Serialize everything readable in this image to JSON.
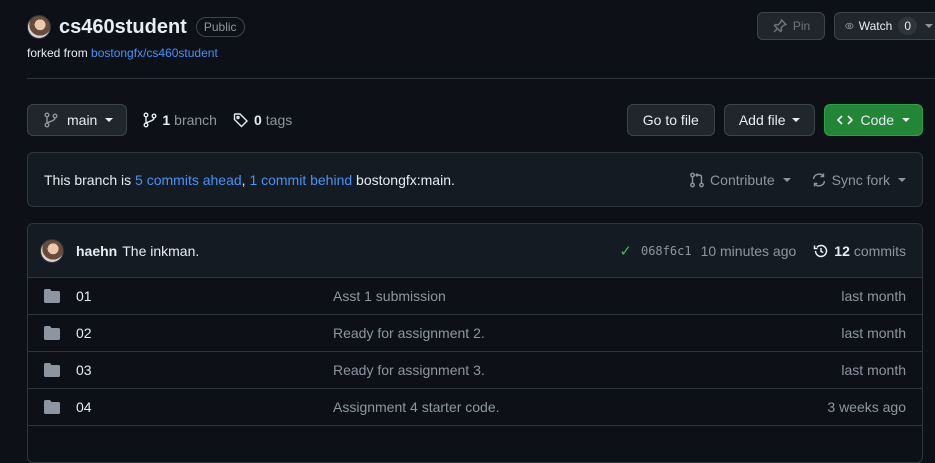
{
  "repo": {
    "name": "cs460student",
    "visibility": "Public",
    "fork_prefix": "forked from",
    "fork_source": "bostongfx/cs460student"
  },
  "header_actions": {
    "pin_label": "Pin",
    "watch_label": "Watch",
    "watch_count": "0"
  },
  "toolbar": {
    "branch_name": "main",
    "branch_count": "1",
    "branch_label": "branch",
    "tag_count": "0",
    "tag_label": "tags",
    "go_to_file": "Go to file",
    "add_file": "Add file",
    "code": "Code"
  },
  "branch_status": {
    "prefix": "This branch is",
    "ahead": "5 commits ahead",
    "sep": ",",
    "behind": "1 commit behind",
    "target": "bostongfx:main."
  },
  "status_actions": {
    "contribute": "Contribute",
    "sync_fork": "Sync fork"
  },
  "latest_commit": {
    "author": "haehn",
    "message": "The inkman.",
    "sha": "068f6c1",
    "time": "10 minutes ago",
    "commit_count": "12",
    "commit_label": "commits"
  },
  "files": [
    {
      "name": "01",
      "message": "Asst 1 submission",
      "time": "last month"
    },
    {
      "name": "02",
      "message": "Ready for assignment 2.",
      "time": "last month"
    },
    {
      "name": "03",
      "message": "Ready for assignment 3.",
      "time": "last month"
    },
    {
      "name": "04",
      "message": "Assignment 4 starter code.",
      "time": "3 weeks ago"
    }
  ],
  "colors": {
    "background": "#0d1117",
    "link": "#4493f8",
    "code_button": "#238636",
    "success_check": "#3fb950"
  }
}
